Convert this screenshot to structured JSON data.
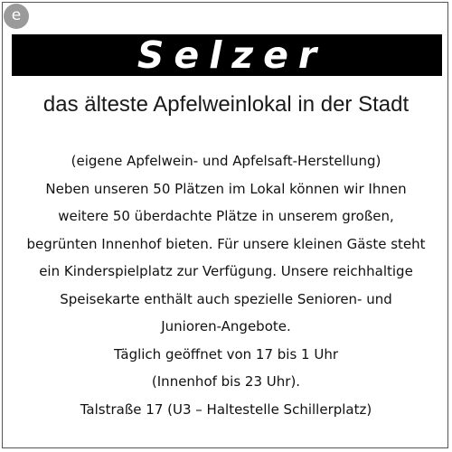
{
  "badge": "e",
  "title": "Selzer",
  "tagline": "das älteste Apfelweinlokal in der Stadt",
  "lines": [
    "(eigene Apfelwein- und Apfelsaft-Herstellung)",
    "Neben unseren 50 Plätzen im Lokal können wir Ihnen",
    "weitere 50 überdachte Plätze in unserem großen,",
    "begrünten Innenhof bieten. Für unsere kleinen Gäste steht",
    "ein Kinderspielplatz zur Verfügung. Unsere reichhaltige",
    "Speisekarte enthält auch spezielle Senioren- und",
    "Junioren-Angebote.",
    "Täglich geöffnet von 17 bis 1 Uhr",
    "(Innenhof bis 23 Uhr).",
    "Talstraße 17 (U3 – Haltestelle Schillerplatz)"
  ]
}
